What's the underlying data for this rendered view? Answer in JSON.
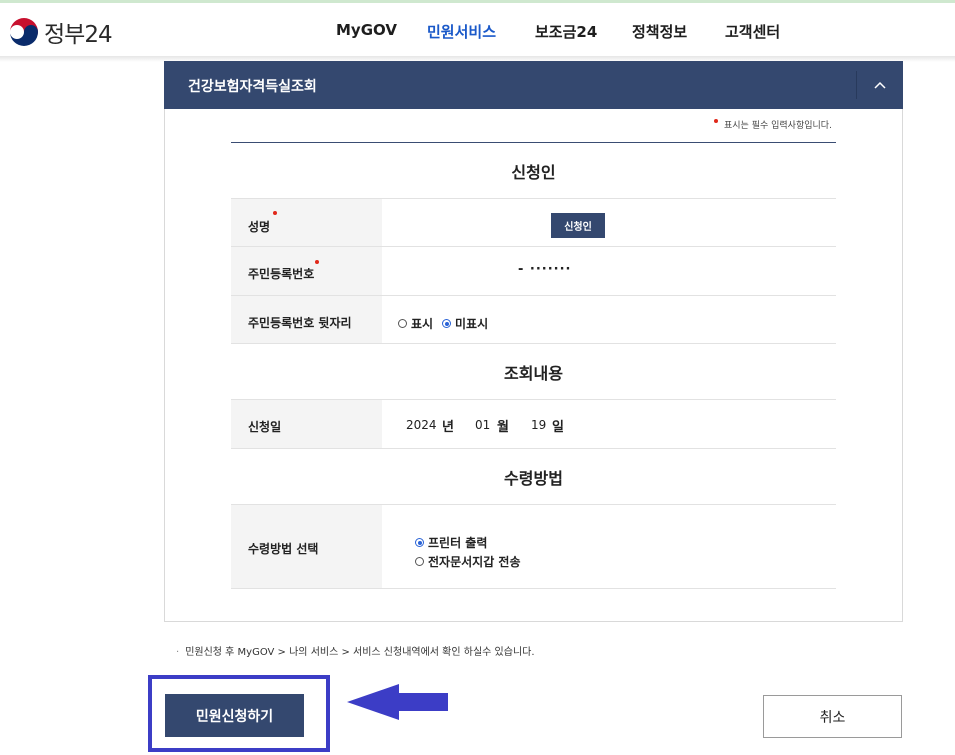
{
  "header": {
    "logo_text": "정부24",
    "nav": [
      {
        "label": "MyGOV",
        "active": false
      },
      {
        "label": "민원서비스",
        "active": true
      },
      {
        "label": "보조금24",
        "active": false
      },
      {
        "label": "정책정보",
        "active": false
      },
      {
        "label": "고객센터",
        "active": false
      }
    ]
  },
  "panel": {
    "title": "건강보험자격득실조회",
    "toggle_icon": "chevron-up-icon",
    "required_note": "표시는 필수 입력사항입니다."
  },
  "applicant": {
    "section_title": "신청인",
    "name_label": "성명",
    "applicant_button": "신청인",
    "rrn_label": "주민등록번호",
    "rrn_value": "- ·······",
    "rrn_back_label": "주민등록번호 뒷자리",
    "show_option": "표시",
    "hide_option": "미표시",
    "selected_option": "미표시"
  },
  "inquiry": {
    "section_title": "조회내용",
    "date_label": "신청일",
    "year": "2024",
    "year_unit": "년",
    "month": "01",
    "month_unit": "월",
    "day": "19",
    "day_unit": "일"
  },
  "receive": {
    "section_title": "수령방법",
    "label": "수령방법 선택",
    "options": [
      "프린터 출력",
      "전자문서지갑 전송"
    ],
    "selected": "프린터 출력"
  },
  "footnote": "민원신청 후 MyGOV > 나의 서비스 > 서비스 신청내역에서 확인 하실수 있습니다.",
  "buttons": {
    "submit": "민원신청하기",
    "cancel": "취소"
  },
  "colors": {
    "primary_navy": "#34486f",
    "active_nav": "#1a59c9",
    "highlight": "#3c3dc6",
    "required_dot": "#e0281a"
  }
}
